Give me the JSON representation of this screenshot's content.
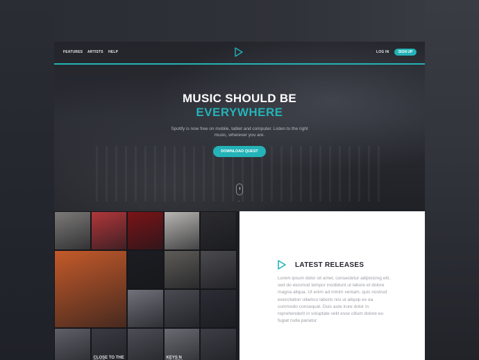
{
  "nav": {
    "features": "FEATURES",
    "artists": "ARTISTS",
    "help": "HELP",
    "login": "LOG IN",
    "signup": "SIGN UP",
    "logo_icon": "play-triangle-logo"
  },
  "hero": {
    "headline_line1": "MUSIC SHOULD BE",
    "headline_line2": "EVERYWHERE",
    "subtext": "Spotify is now free on mobile, tablet and computer. Listen to the right music, wherever you are.",
    "cta": "DOWNLOAD QUEST",
    "scroll_icon": "mouse-scroll-icon"
  },
  "albums": [
    {
      "label": "",
      "color": "#7c7a78"
    },
    {
      "label": "",
      "color": "#b0373b"
    },
    {
      "label": "",
      "color": "#7a1418"
    },
    {
      "label": "",
      "color": "#b8b6b2"
    },
    {
      "label": "",
      "color": "#2c2c30"
    },
    {
      "label": "",
      "color": "#c45a2a"
    },
    {
      "label": "",
      "color": "#1c1d22"
    },
    {
      "label": "",
      "color": "#5e5c58"
    },
    {
      "label": "",
      "color": "#4b4a4e"
    },
    {
      "label": "",
      "color": "#70717a"
    },
    {
      "label": "",
      "color": "#4a4b52"
    },
    {
      "label": "",
      "color": "#2c2d35"
    },
    {
      "label": "",
      "color": "#5f6068"
    },
    {
      "label": "CLOSE TO THE EDGE",
      "color": "#3a3c44"
    },
    {
      "label": "",
      "color": "#4d4e56"
    },
    {
      "label": "KEYS N KRATES",
      "color": "#6a6b72"
    },
    {
      "label": "",
      "color": "#3d3e46"
    }
  ],
  "releases": {
    "icon": "play-triangle-icon",
    "title": "LATEST RELEASES",
    "body": "Lorem ipsum dolor sit amet, consectetur adipisicing elit, sed do eiusmod tempor incididunt ut labore et dolore magna aliqua. Ut enim ad minim veniam, quis nostrud exercitation ullamco laboris nisi ut aliquip ex ea commodo consequat. Duis aute irure dolor in reprehenderit in voluptate velit esse cillum dolore eu fugiat nulla pariatur."
  },
  "colors": {
    "accent": "#23b3b8",
    "dark": "#1c1e24",
    "panel": "#ffffff"
  }
}
